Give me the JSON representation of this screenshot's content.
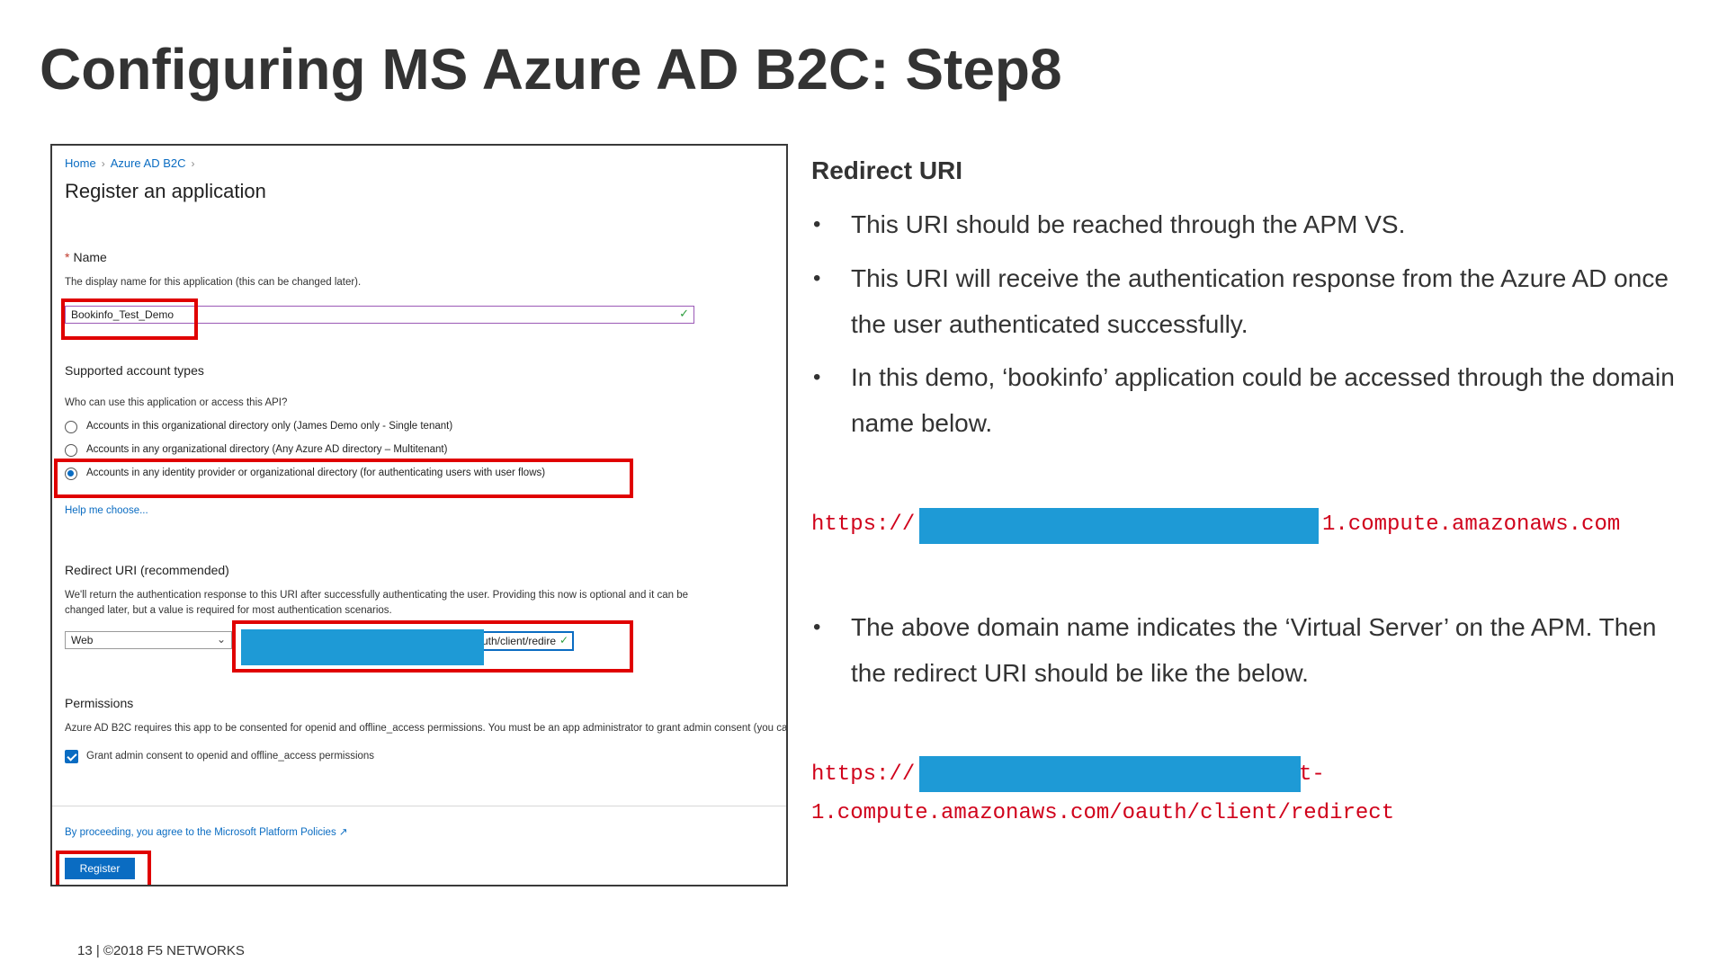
{
  "slide": {
    "title": "Configuring MS Azure AD B2C: Step8",
    "footer": "13 | ©2018 F5 NETWORKS"
  },
  "portal": {
    "breadcrumb": [
      "Home",
      "Azure AD B2C"
    ],
    "page_title": "Register an application",
    "name": {
      "required_mark": "*",
      "label": "Name",
      "help": "The display name for this application (this can be changed later).",
      "value": "Bookinfo_Test_Demo"
    },
    "account_types": {
      "label": "Supported account types",
      "question": "Who can use this application or access this API?",
      "options": [
        {
          "label": "Accounts in this organizational directory only (James Demo only - Single tenant)",
          "selected": false
        },
        {
          "label": "Accounts in any organizational directory (Any Azure AD directory – Multitenant)",
          "selected": false
        },
        {
          "label": "Accounts in any identity provider or organizational directory (for authenticating users with user flows)",
          "selected": true
        }
      ],
      "help_link": "Help me choose..."
    },
    "redirect": {
      "label": "Redirect URI (recommended)",
      "help_line1": "We'll return the authentication response to this URI after successfully authenticating the user. Providing this now is optional and it can be",
      "help_line2": "changed later, but a value is required for most authentication scenarios.",
      "platform": "Web",
      "uri_visible": "uth/client/redire"
    },
    "permissions": {
      "label": "Permissions",
      "help": "Azure AD B2C requires this app to be consented for openid and offline_access permissions. You must be an app administrator to grant admin consent (you can do",
      "checkbox_label": "Grant admin consent to openid and offline_access permissions",
      "checked": true
    },
    "policy_text": "By proceeding, you agree to the Microsoft Platform Policies",
    "register_label": "Register"
  },
  "notes": {
    "heading": "Redirect URI",
    "bullet_char": "•",
    "bullets_top": [
      "This URI should be reached through the APM VS.",
      "This URI will receive the authentication response from the Azure AD once the user authenticated successfully.",
      "In this demo, ‘bookinfo’ application could be accessed through the domain name below."
    ],
    "url1_prefix": "https://",
    "url1_suffix": "1.compute.amazonaws.com",
    "bullet_bottom": "The above domain name indicates the ‘Virtual Server’ on the APM. Then the redirect URI should be like the below.",
    "url2_prefix": "https://",
    "url2_suffix_line1": "t-",
    "url2_line2": "1.compute.amazonaws.com/oauth/client/redirect"
  },
  "colors": {
    "highlight": "#e00000",
    "redaction": "#1e9ad6",
    "link": "#0a6cc2",
    "code": "#d0021b"
  }
}
